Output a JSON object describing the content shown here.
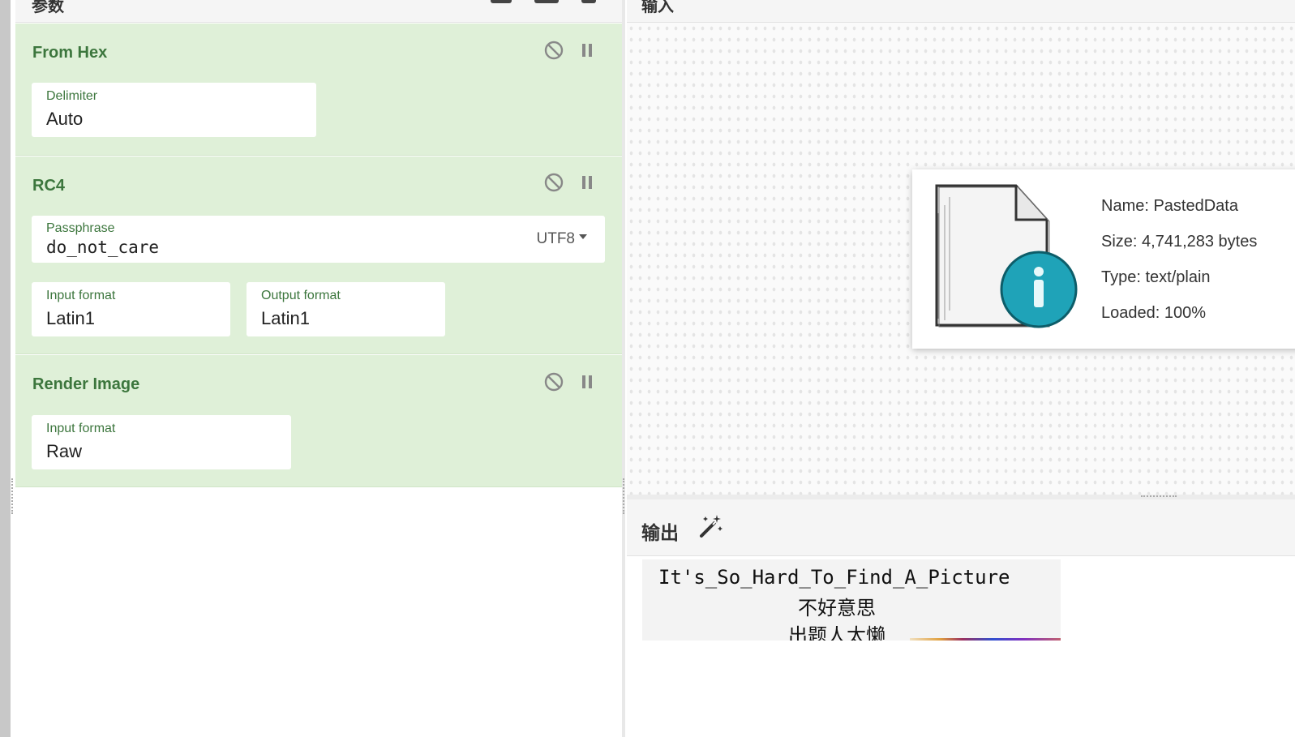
{
  "recipe": {
    "header_title": "参数",
    "operations": [
      {
        "title": "From Hex",
        "fields": [
          {
            "label": "Delimiter",
            "value": "Auto"
          }
        ]
      },
      {
        "title": "RC4",
        "passphrase": {
          "label": "Passphrase",
          "value": "do_not_care",
          "encoding": "UTF8"
        },
        "fields": [
          {
            "label": "Input format",
            "value": "Latin1"
          },
          {
            "label": "Output format",
            "value": "Latin1"
          }
        ]
      },
      {
        "title": "Render Image",
        "fields": [
          {
            "label": "Input format",
            "value": "Raw"
          }
        ]
      }
    ]
  },
  "input": {
    "header_title": "输入",
    "file": {
      "name": "Name: PastedData",
      "size": "Size: 4,741,283 bytes",
      "type": "Type: text/plain",
      "loaded": "Loaded: 100%"
    }
  },
  "output": {
    "header_title": "输出",
    "magic_icon": "magic-wand-icon",
    "rendered_text": [
      "It's_So_Hard_To_Find_A_Picture",
      "不好意思",
      "出题人太懒"
    ]
  },
  "colors": {
    "operation_bg": "#dff0d8",
    "operation_title": "#3c763d",
    "file_icon_accent": "#1fa3b8"
  }
}
